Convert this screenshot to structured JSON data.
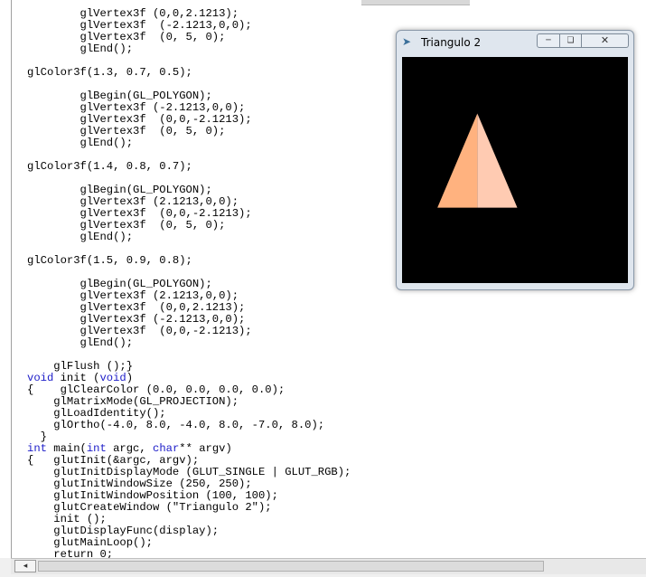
{
  "code_lines": [
    "        glVertex3f (0,0,2.1213);",
    "        glVertex3f  (-2.1213,0,0);",
    "        glVertex3f  (0, 5, 0);",
    "        glEnd();",
    "",
    "glColor3f(1.3, 0.7, 0.5);",
    "",
    "        glBegin(GL_POLYGON);",
    "        glVertex3f (-2.1213,0,0);",
    "        glVertex3f  (0,0,-2.1213);",
    "        glVertex3f  (0, 5, 0);",
    "        glEnd();",
    "",
    "glColor3f(1.4, 0.8, 0.7);",
    "",
    "        glBegin(GL_POLYGON);",
    "        glVertex3f (2.1213,0,0);",
    "        glVertex3f  (0,0,-2.1213);",
    "        glVertex3f  (0, 5, 0);",
    "        glEnd();",
    "",
    "glColor3f(1.5, 0.9, 0.8);",
    "",
    "        glBegin(GL_POLYGON);",
    "        glVertex3f (2.1213,0,0);",
    "        glVertex3f  (0,0,2.1213);",
    "        glVertex3f (-2.1213,0,0);",
    "        glVertex3f  (0,0,-2.1213);",
    "        glEnd();",
    "",
    "    glFlush ();}",
    "void init (void)",
    "{    glClearColor (0.0, 0.0, 0.0, 0.0);",
    "    glMatrixMode(GL_PROJECTION);",
    "    glLoadIdentity();",
    "    glOrtho(-4.0, 8.0, -4.0, 8.0, -7.0, 8.0);",
    "  }",
    "int main(int argc, char** argv)",
    "{   glutInit(&argc, argv);",
    "    glutInitDisplayMode (GLUT_SINGLE | GLUT_RGB);",
    "    glutInitWindowSize (250, 250);",
    "    glutInitWindowPosition (100, 100);",
    "    glutCreateWindow (\"Triangulo 2\");",
    "    init ();",
    "    glutDisplayFunc(display);",
    "    glutMainLoop();",
    "    return 0;"
  ],
  "keywords": [
    "void",
    "int",
    "char"
  ],
  "gl_window": {
    "title": "Triangulo 2",
    "icons": {
      "app": "glut-app-icon",
      "minimize": "minimize-icon",
      "maximize": "maximize-icon",
      "close": "close-icon"
    },
    "clear_color": "#000000",
    "ortho": [
      -4.0,
      8.0,
      -4.0,
      8.0
    ],
    "faces": [
      {
        "color": "#ffb27f",
        "vertices": [
          [
            -2.1213,
            0
          ],
          [
            0,
            0
          ],
          [
            0,
            5
          ]
        ]
      },
      {
        "color": "#ffcbb2",
        "vertices": [
          [
            0,
            0
          ],
          [
            2.1213,
            0
          ],
          [
            0,
            5
          ]
        ]
      }
    ]
  },
  "colors": {
    "editor_bg": "#ffffff",
    "keyword": "#1c1cc8",
    "text": "#000000"
  },
  "scrollbar": {
    "left_arrow": "◂"
  }
}
